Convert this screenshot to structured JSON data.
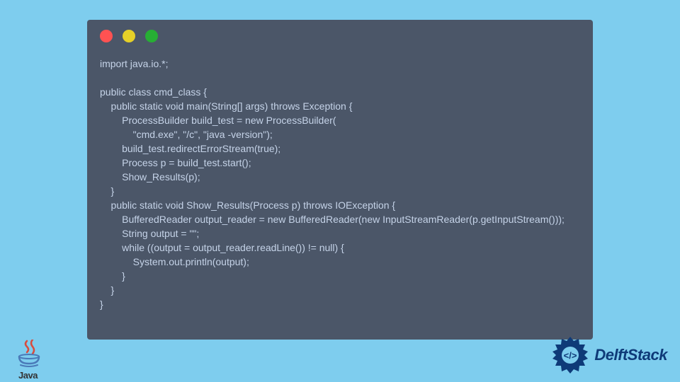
{
  "code": {
    "content": "import java.io.*;\n\npublic class cmd_class {\n    public static void main(String[] args) throws Exception {\n        ProcessBuilder build_test = new ProcessBuilder(\n            \"cmd.exe\", \"/c\", \"java -version\");\n        build_test.redirectErrorStream(true);\n        Process p = build_test.start();\n        Show_Results(p);\n    }\n    public static void Show_Results(Process p) throws IOException {\n        BufferedReader output_reader = new BufferedReader(new InputStreamReader(p.getInputStream()));\n        String output = \"\";\n        while ((output = output_reader.readLine()) != null) {\n            System.out.println(output);\n        }\n    }\n}"
  },
  "logos": {
    "java_label": "Java",
    "delftstack_label": "DelftStack"
  },
  "colors": {
    "background": "#7ecdee",
    "window_bg": "#4b5668",
    "code_text": "#c5d3e8",
    "dot_red": "#ff5252",
    "dot_yellow": "#e6d028",
    "dot_green": "#27ae34",
    "delftstack_blue": "#0e3a78"
  }
}
